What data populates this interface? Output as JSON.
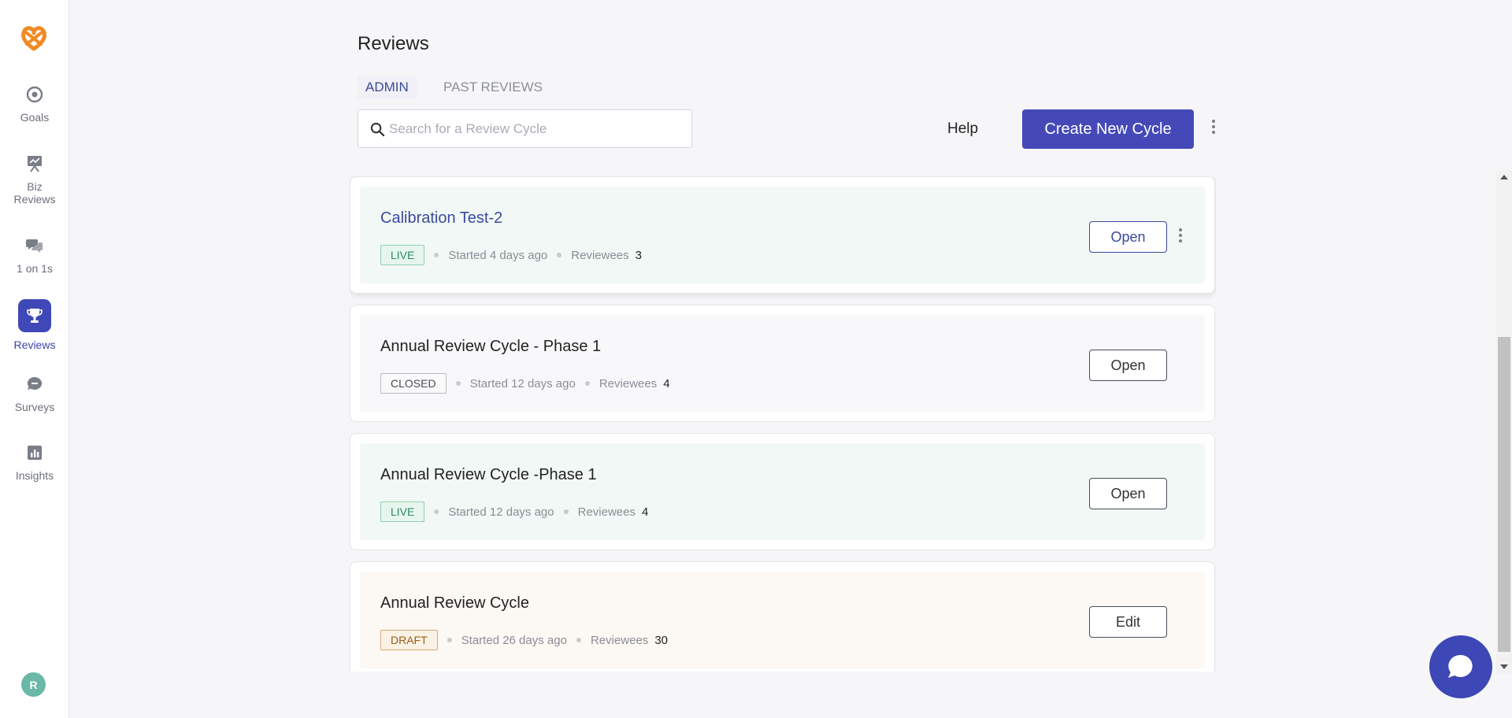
{
  "sidebar": {
    "logo": "pretzel-logo",
    "items": [
      {
        "label": "Goals",
        "icon": "target-icon"
      },
      {
        "label": "Biz Reviews",
        "icon": "presentation-icon"
      },
      {
        "label": "1 on 1s",
        "icon": "chat-bubbles-icon"
      },
      {
        "label": "Reviews",
        "icon": "trophy-icon",
        "active": true
      },
      {
        "label": "Surveys",
        "icon": "survey-bubble-icon"
      },
      {
        "label": "Insights",
        "icon": "bar-chart-icon"
      }
    ],
    "avatar_initial": "R"
  },
  "header": {
    "title": "Reviews",
    "tabs": [
      {
        "label": "ADMIN",
        "active": true
      },
      {
        "label": "PAST REVIEWS",
        "active": false
      }
    ],
    "search_placeholder": "Search for a Review Cycle",
    "help_label": "Help",
    "create_label": "Create New Cycle"
  },
  "cycles": [
    {
      "title": "Calibration Test-2",
      "status": "LIVE",
      "started": "Started 4 days ago",
      "reviewees_label": "Reviewees",
      "reviewees": "3",
      "action": "Open"
    },
    {
      "title": "Annual Review Cycle - Phase 1",
      "status": "CLOSED",
      "started": "Started 12 days ago",
      "reviewees_label": "Reviewees",
      "reviewees": "4",
      "action": "Open"
    },
    {
      "title": "Annual Review Cycle -Phase 1",
      "status": "LIVE",
      "started": "Started 12 days ago",
      "reviewees_label": "Reviewees",
      "reviewees": "4",
      "action": "Open"
    },
    {
      "title": "Annual Review Cycle",
      "status": "DRAFT",
      "started": "Started 26 days ago",
      "reviewees_label": "Reviewees",
      "reviewees": "30",
      "action": "Edit"
    }
  ],
  "colors": {
    "accent": "#4549b8",
    "live": "#2f8a60",
    "draft": "#9a5c14"
  }
}
